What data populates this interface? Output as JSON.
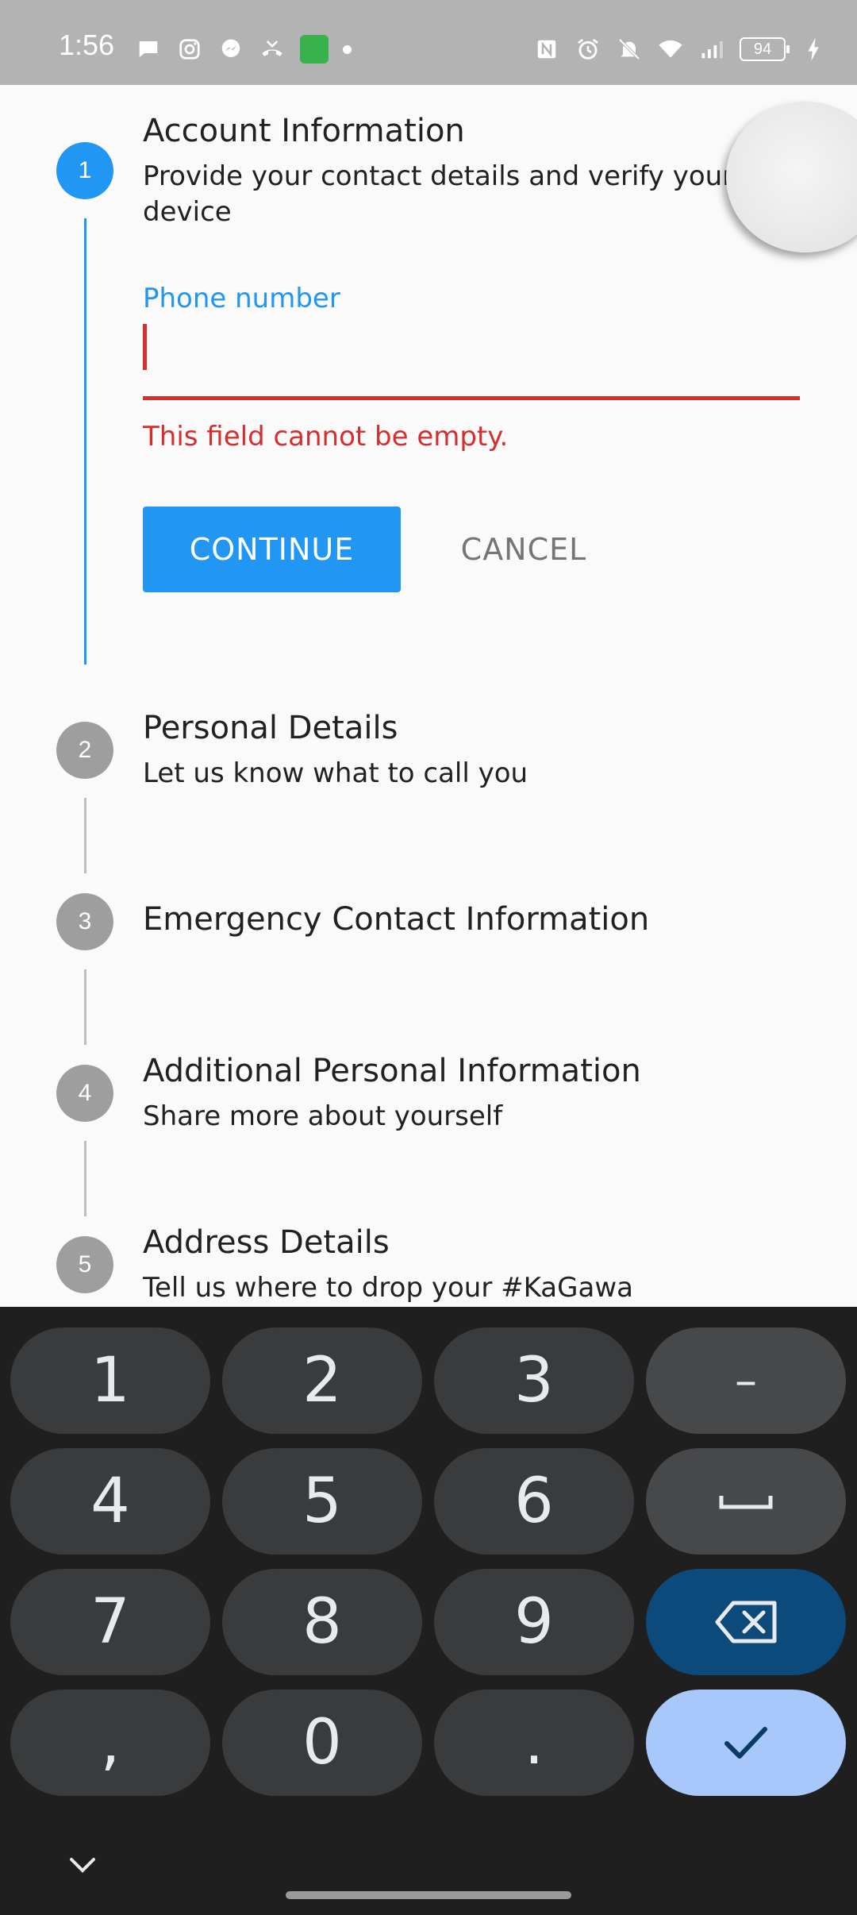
{
  "status_bar": {
    "time": "1:56",
    "battery": "94",
    "left_icons": [
      "chat-icon",
      "instagram-icon",
      "messenger-icon",
      "missed-call-icon",
      "app-icon",
      "dot-icon"
    ],
    "right_icons": [
      "nfc-icon",
      "alarm-icon",
      "mute-icon",
      "wifi-icon",
      "signal-icon",
      "battery-icon",
      "charging-icon"
    ]
  },
  "stepper": {
    "steps": [
      {
        "number": "1",
        "title": "Account Information",
        "subtitle": "Provide your contact details and verify your device",
        "active": true
      },
      {
        "number": "2",
        "title": "Personal Details",
        "subtitle": "Let us know what to call you",
        "active": false
      },
      {
        "number": "3",
        "title": "Emergency Contact Information",
        "subtitle": "",
        "active": false
      },
      {
        "number": "4",
        "title": "Additional Personal Information",
        "subtitle": "Share more about yourself",
        "active": false
      },
      {
        "number": "5",
        "title": "Address Details",
        "subtitle": "Tell us where to drop your #KaGawa",
        "active": false
      }
    ],
    "phone_field": {
      "label": "Phone number",
      "value": "",
      "error": "This field cannot be empty."
    },
    "continue_label": "CONTINUE",
    "cancel_label": "CANCEL"
  },
  "keyboard": {
    "rows": [
      [
        "1",
        "2",
        "3",
        "–"
      ],
      [
        "4",
        "5",
        "6",
        "␣"
      ],
      [
        "7",
        "8",
        "9",
        "⌫"
      ],
      [
        ",",
        "0",
        ".",
        "✓"
      ]
    ],
    "colors": {
      "key": "#3a3b3d",
      "function_key": "#47484a",
      "delete_key": "#0b4a7a",
      "enter_key": "#a8c7fa",
      "background": "#1f1f1f"
    }
  },
  "colors": {
    "accent": "#2196f3",
    "error": "#d32f2f",
    "inactive_step": "#9e9e9e"
  }
}
